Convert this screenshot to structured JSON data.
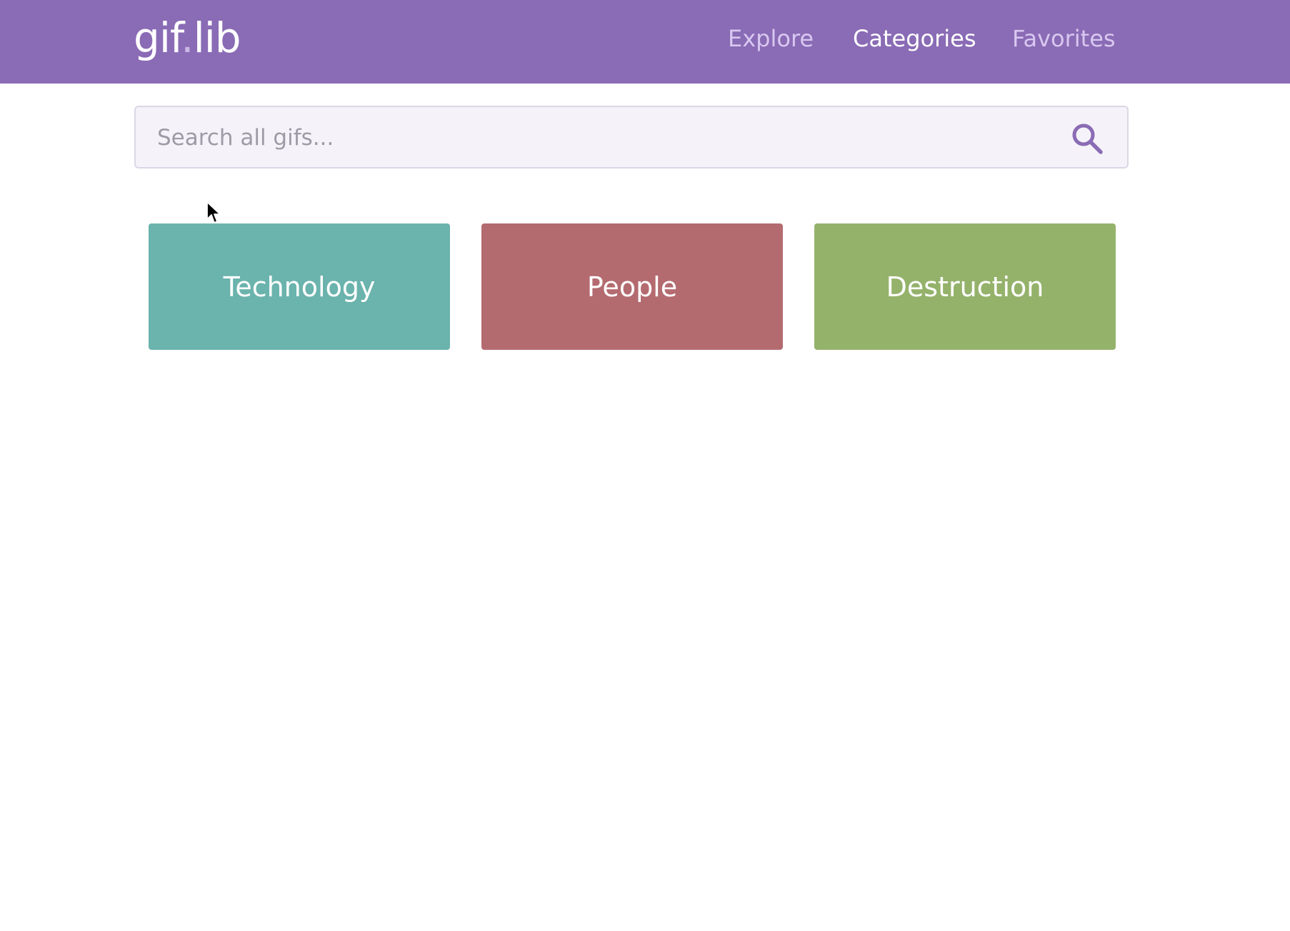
{
  "header": {
    "logo_main": "gif",
    "logo_dot": ".",
    "logo_tail": "lib",
    "nav": [
      {
        "label": "Explore",
        "active": false
      },
      {
        "label": "Categories",
        "active": true
      },
      {
        "label": "Favorites",
        "active": false
      }
    ],
    "bg_color": "#8a6bb5"
  },
  "search": {
    "placeholder": "Search all gifs...",
    "value": "",
    "icon": "search-icon"
  },
  "categories": [
    {
      "label": "Technology",
      "color": "#6bb3ad"
    },
    {
      "label": "People",
      "color": "#b46b70"
    },
    {
      "label": "Destruction",
      "color": "#95b26b"
    }
  ]
}
